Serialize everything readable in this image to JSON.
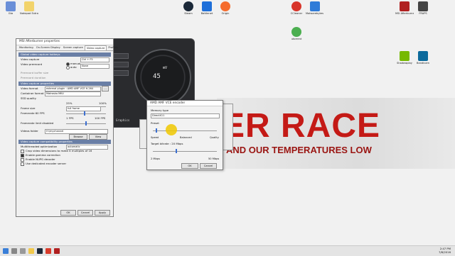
{
  "wallpaper": {
    "title": "ER RACE",
    "subtitle": "AND OUR TEMPERATURES LOW"
  },
  "desktop_icons": [
    {
      "label": "Gta",
      "color": "#6a8fd8"
    },
    {
      "label": "Notepad Extra",
      "color": "#f2d36b"
    },
    {
      "label": "Steam",
      "color": "#1b2838"
    },
    {
      "label": "Battlenet",
      "color": "#1e6fd9"
    },
    {
      "label": "Origin",
      "color": "#f56c2d"
    },
    {
      "label": "CCleaner",
      "color": "#d8352a"
    },
    {
      "label": "Malwarebytes Anti-Malware",
      "color": "#2f7bd8"
    },
    {
      "label": "MSI Afterburner",
      "color": "#b02020"
    },
    {
      "label": "FRAPS",
      "color": "#444444"
    },
    {
      "label": "utorrent",
      "color": "#4caf50"
    },
    {
      "label": "Shadowplay",
      "color": "#76b900"
    },
    {
      "label": "Bandicam",
      "color": "#0c6a9c"
    }
  ],
  "afterburner": {
    "voltage": "mV",
    "temp": "45",
    "graphics": "Graphics"
  },
  "properties": {
    "title": "MSI Afterburner properties",
    "tabs": [
      "Monitoring",
      "On-Screen Display",
      "Screen capture",
      "Video capture",
      "Profiles"
    ],
    "active_tab": "Video capture",
    "hotkeys_header": "Global video capture hotkeys",
    "video_capture_label": "Video capture",
    "video_capture_key": "Ctrl + F5",
    "prerecord_label": "Video prerecord",
    "mode_manual": "manual",
    "mode_auto": "auto",
    "prerecord_key": "None",
    "prerecord_buffer_label": "Prerecord buffer size",
    "prerecord_duration_label": "Prerecord duration",
    "properties_header": "Video capture properties",
    "video_format_label": "Video format",
    "video_format_value": "external plugin : AMD AMF VCE H.264",
    "container_label": "Container format",
    "container_value": "Matroska MKV",
    "quality_label": "SSD quality",
    "quality_min": "25%",
    "quality_max": "100%",
    "frame_size_label": "Frame size",
    "frame_size_value": "full frame",
    "framerate_label": "Framerate 60 FPS",
    "framerate_min": "1 FPS",
    "framerate_max": "100 FPS",
    "limit_label": "Framerate limit disabled",
    "folder_label": "Videos folder",
    "folder_value": "H:\\mychannel",
    "browse": "Browse",
    "view": "View",
    "compat_header": "Video capture compatibility properties",
    "multithreaded_label": "Multithreaded optimization",
    "multithreaded_value": "automatic",
    "opt1": "Crop video dimensions to make it multiples of 16",
    "opt2": "Enable gamma correction",
    "opt3": "Enable NUPG decoder",
    "opt4": "Use dedicated encoder server",
    "ok": "OK",
    "cancel": "Cancel",
    "apply": "Apply"
  },
  "encoder": {
    "title": "AMD AMF VCE encoder",
    "memory_label": "Memory type",
    "memory_value": "DirectX11",
    "preset_label": "Preset",
    "speed": "Speed",
    "balanced": "Balanced",
    "quality": "Quality",
    "bitrate_label": "Target bitrate : 20 Mbps",
    "min": "2 Mbps",
    "max": "50 Mbps",
    "ok": "OK",
    "cancel": "Cancel"
  },
  "taskbar": {
    "time": "2:47 PM",
    "date": "7/8/2016"
  }
}
